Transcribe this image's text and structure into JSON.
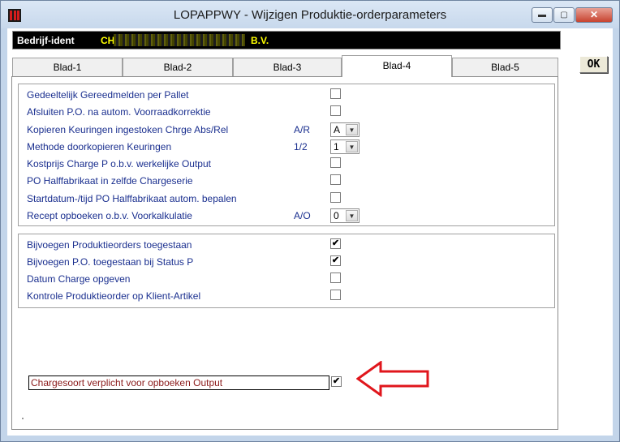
{
  "window": {
    "title": "LOPAPPWY - Wijzigen Produktie-orderparameters",
    "controls": {
      "minimize": "▬",
      "maximize": "▢",
      "close": "✕"
    }
  },
  "ident": {
    "label": "Bedrijf-ident",
    "value_start": "CH",
    "value_end": "B.V."
  },
  "ok_button": {
    "label": "OK"
  },
  "tabs": [
    {
      "label": "Blad-1",
      "active": false
    },
    {
      "label": "Blad-2",
      "active": false
    },
    {
      "label": "Blad-3",
      "active": false
    },
    {
      "label": "Blad-4",
      "active": true
    },
    {
      "label": "Blad-5",
      "active": false
    }
  ],
  "group1": [
    {
      "label": "Gedeeltelijk Gereedmelden per Pallet",
      "type": "checkbox",
      "checked": false
    },
    {
      "label": "Afsluiten P.O. na autom. Voorraadkorrektie",
      "type": "checkbox",
      "checked": false
    },
    {
      "label": "Kopieren Keuringen ingestoken Chrge Abs/Rel",
      "code": "A/R",
      "type": "select",
      "value": "A"
    },
    {
      "label": "Methode doorkopieren Keuringen",
      "code": "1/2",
      "type": "select",
      "value": "1"
    },
    {
      "label": "Kostprijs Charge P o.b.v. werkelijke Output",
      "type": "checkbox",
      "checked": false
    },
    {
      "label": "PO Halffabrikaat in zelfde Chargeserie",
      "type": "checkbox",
      "checked": false
    },
    {
      "label": "Startdatum-/tijd PO Halffabrikaat autom. bepalen",
      "type": "checkbox",
      "checked": false
    },
    {
      "label": "Recept opboeken o.b.v. Voorkalkulatie",
      "code": "A/O",
      "type": "select",
      "value": "0"
    }
  ],
  "group2": [
    {
      "label": "Bijvoegen Produktieorders toegestaan",
      "type": "checkbox",
      "checked": true
    },
    {
      "label": "Bijvoegen P.O. toegestaan bij Status P",
      "type": "checkbox",
      "checked": true
    },
    {
      "label": "Datum Charge opgeven",
      "type": "checkbox",
      "checked": false
    },
    {
      "label": "Kontrole Produktieorder op Klient-Artikel",
      "type": "checkbox",
      "checked": false
    }
  ],
  "special": {
    "label": "Chargesoort verplicht voor opboeken Output",
    "checked": true
  },
  "colors": {
    "label_text": "#1a2f8f",
    "special_text": "#8b1a1a",
    "annotation_arrow": "#e0161c",
    "ident_value": "#ffff00"
  },
  "icons": {
    "checked_mark": "✔",
    "dropdown": "▼"
  }
}
